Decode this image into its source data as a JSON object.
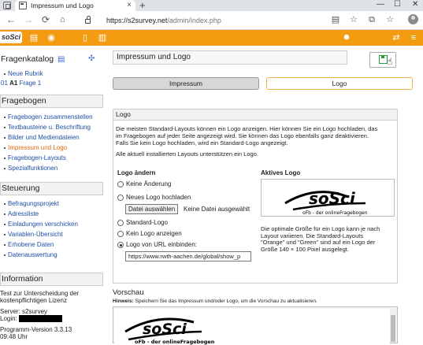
{
  "browser": {
    "tab_title": "Impressum und Logo",
    "url_host": "https://s2survey.net",
    "url_path": "/admin/index.php",
    "new_tab": "+",
    "close_tab": "×",
    "win_min": "—",
    "win_max": "☐",
    "win_close": "✕"
  },
  "app": {
    "logo_text": "soSci",
    "accent": "#f39c12"
  },
  "sidebar": {
    "fragenkatalog": {
      "title": "Fragenkatalog",
      "items": [
        {
          "label": "Neue Rubrik"
        },
        {
          "prefix": "01",
          "code": "A1",
          "label": "Frage 1"
        }
      ]
    },
    "fragebogen": {
      "title": "Fragebogen",
      "items": [
        {
          "label": "Fragebogen zusammenstellen",
          "active": false
        },
        {
          "label": "Textbausteine u. Beschriftung",
          "active": false
        },
        {
          "label": "Bilder und Mediendateien",
          "active": false
        },
        {
          "label": "Impressum und Logo",
          "active": true
        },
        {
          "label": "Fragebogen-Layouts",
          "active": false
        },
        {
          "label": "Spezialfunktionen",
          "active": false
        }
      ]
    },
    "steuerung": {
      "title": "Steuerung",
      "items": [
        {
          "label": "Befragungsprojekt"
        },
        {
          "label": "Adressliste"
        },
        {
          "label": "Einladungen verschicken"
        },
        {
          "label": "Variablen-Übersicht"
        },
        {
          "label": "Erhobene Daten"
        },
        {
          "label": "Datenauswertung"
        }
      ]
    },
    "information": {
      "title": "Information",
      "line1": "Test zur Unterscheidung der",
      "line2": "kostenpflichtigen Lizenz",
      "server": "Server: s2survey",
      "login": "Login:",
      "version": "Programm-Version 3.3.13",
      "time": "09:48 Uhr"
    }
  },
  "main": {
    "page_title": "Impressum und Logo",
    "tabs": [
      "Impressum",
      "Logo"
    ],
    "panel": {
      "title": "Logo",
      "intro1": "Die meisten Standard-Layouts können ein Logo anzeigen. Hier können Sie ein Logo hochladen, das",
      "intro2": "im Fragebogen auf jeder Seite angezeigt wird. Sie können das Logo ebenfalls ganz deaktivieren.",
      "intro3": "Falls Sie kein Logo hochladen, wird ein Standard-Logo angezeigt.",
      "intro4": "Alle aktuell installierten Layouts unterstützen ein Logo.",
      "logo_aendern": "Logo ändern",
      "aktives_logo": "Aktives Logo",
      "options": [
        {
          "label": "Keine Änderung",
          "selected": false
        },
        {
          "label": "Neues Logo hochladen",
          "selected": false
        },
        {
          "label": "Standard-Logo",
          "selected": false
        },
        {
          "label": "Kein Logo anzeigen",
          "selected": false
        },
        {
          "label": "Logo von URL einbinden:",
          "selected": true
        }
      ],
      "file_button": "Datei auswählen",
      "file_none": "Keine Datei ausgewählt",
      "url_value": "https://www.rwth-aachen.de/global/show_p",
      "desc1": "Die optimale Größe für ein Logo kann je nach",
      "desc2": "Layout variieren. Die Standard-Layouts",
      "desc3": "\"Orange\" und \"Green\" sind auf ein Logo der",
      "desc4": "Größe 140 × 100 Pixel ausgelegt."
    },
    "preview_title": "Vorschau",
    "hinweis_label": "Hinweis:",
    "hinweis_text": "Speichern Sie das Impressum und/oder Logo, um die Vorschau zu aktualisieren.",
    "logo_big": "soSci",
    "logo_sub": "oFb - der onlineFragebogen"
  }
}
